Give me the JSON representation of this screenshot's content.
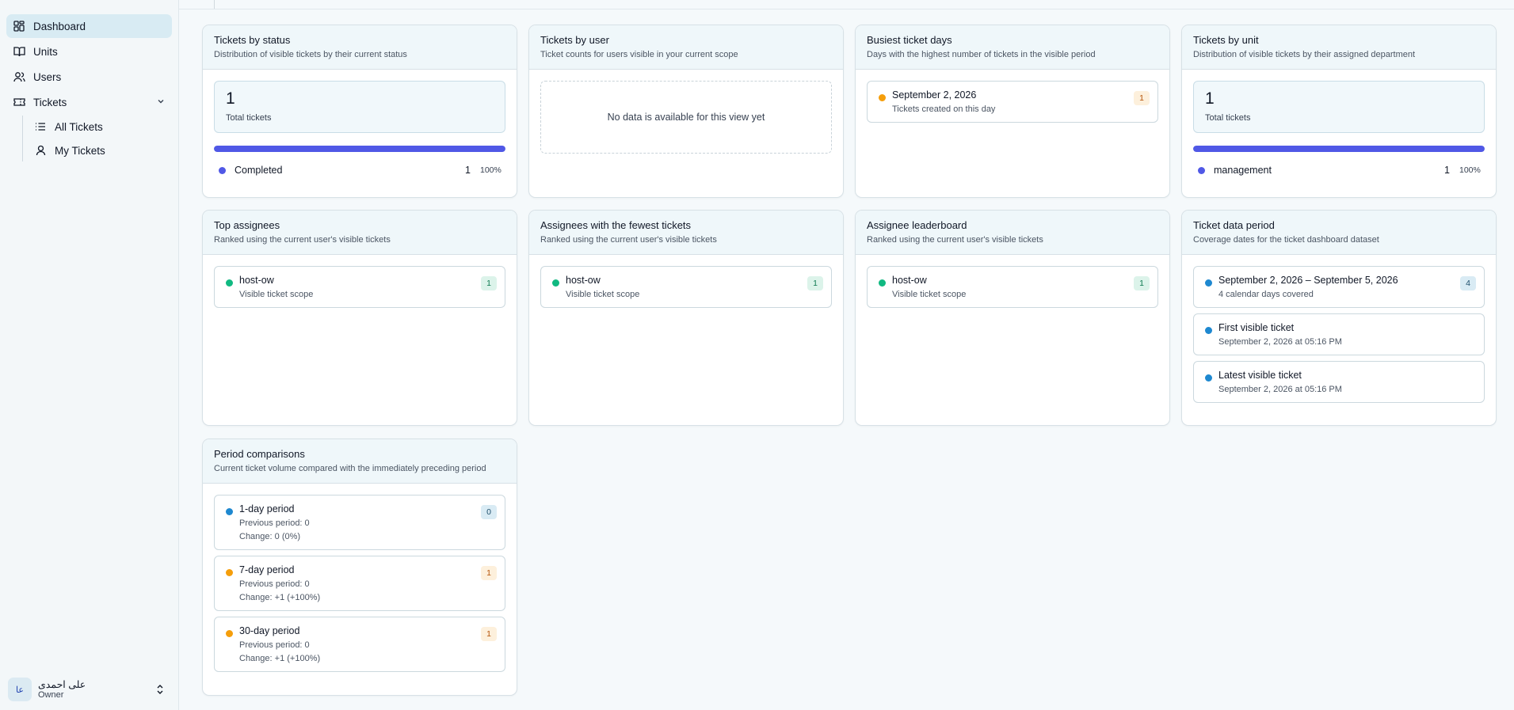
{
  "colors": {
    "accent_bar": "#5058e6",
    "dot_indigo": "#5058e6",
    "dot_green": "#10b981",
    "dot_orange": "#f59e0b",
    "dot_blue": "#1e88d0"
  },
  "sidebar": {
    "items": [
      {
        "label": "Dashboard",
        "icon": "dashboard-icon"
      },
      {
        "label": "Units",
        "icon": "book-icon"
      },
      {
        "label": "Users",
        "icon": "users-icon"
      },
      {
        "label": "Tickets",
        "icon": "ticket-icon"
      }
    ],
    "sub_items": [
      {
        "label": "All Tickets",
        "icon": "list-icon"
      },
      {
        "label": "My Tickets",
        "icon": "user-icon"
      }
    ],
    "user": {
      "initials": "عا",
      "name": "علی احمدی",
      "role": "Owner"
    }
  },
  "cards": {
    "status": {
      "title": "Tickets by status",
      "subtitle": "Distribution of visible tickets by their current status",
      "total": "1",
      "total_label": "Total tickets",
      "fill_fraction": 1.0,
      "legend": {
        "name": "Completed",
        "count": "1",
        "pct": "100%"
      }
    },
    "by_user": {
      "title": "Tickets by user",
      "subtitle": "Ticket counts for users visible in your current scope",
      "empty": "No data is available for this view yet"
    },
    "busiest": {
      "title": "Busiest ticket days",
      "subtitle": "Days with the highest number of tickets in the visible period",
      "item": {
        "title": "September 2, 2026",
        "sub": "Tickets created on this day",
        "badge": "1"
      }
    },
    "by_unit": {
      "title": "Tickets by unit",
      "subtitle": "Distribution of visible tickets by their assigned department",
      "total": "1",
      "total_label": "Total tickets",
      "fill_fraction": 1.0,
      "legend": {
        "name": "management",
        "count": "1",
        "pct": "100%"
      }
    },
    "top_assignees": {
      "title": "Top assignees",
      "subtitle": "Ranked using the current user's visible tickets",
      "item": {
        "title": "host-ow",
        "sub": "Visible ticket scope",
        "badge": "1"
      }
    },
    "fewest": {
      "title": "Assignees with the fewest tickets",
      "subtitle": "Ranked using the current user's visible tickets",
      "item": {
        "title": "host-ow",
        "sub": "Visible ticket scope",
        "badge": "1"
      }
    },
    "leaderboard": {
      "title": "Assignee leaderboard",
      "subtitle": "Ranked using the current user's visible tickets",
      "item": {
        "title": "host-ow",
        "sub": "Visible ticket scope",
        "badge": "1"
      }
    },
    "data_period": {
      "title": "Ticket data period",
      "subtitle": "Coverage dates for the ticket dashboard dataset",
      "items": [
        {
          "title": "September 2, 2026 – September 5, 2026",
          "sub": "4 calendar days covered",
          "badge": "4"
        },
        {
          "title": "First visible ticket",
          "sub": "September 2, 2026 at 05:16 PM"
        },
        {
          "title": "Latest visible ticket",
          "sub": "September 2, 2026 at 05:16 PM"
        }
      ]
    },
    "comparisons": {
      "title": "Period comparisons",
      "subtitle": "Current ticket volume compared with the immediately preceding period",
      "items": [
        {
          "title": "1-day period",
          "prev": "Previous period: 0",
          "change": "Change: 0 (0%)",
          "badge": "0"
        },
        {
          "title": "7-day period",
          "prev": "Previous period: 0",
          "change": "Change: +1 (+100%)",
          "badge": "1"
        },
        {
          "title": "30-day period",
          "prev": "Previous period: 0",
          "change": "Change: +1 (+100%)",
          "badge": "1"
        }
      ]
    }
  }
}
